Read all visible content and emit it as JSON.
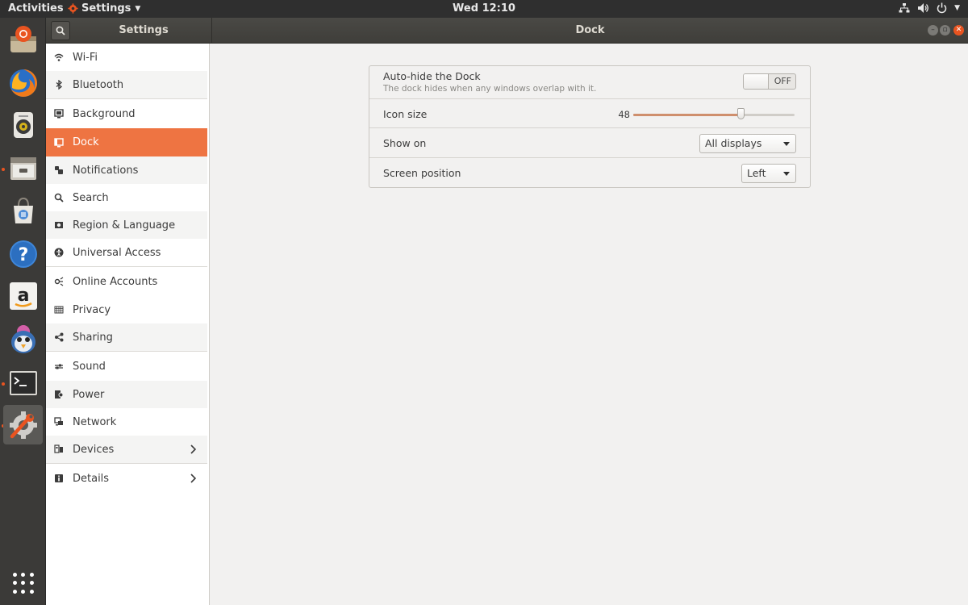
{
  "topbar": {
    "activities": "Activities",
    "app_name": "Settings",
    "clock": "Wed 12:10",
    "tray_icons": [
      "network-icon",
      "volume-icon",
      "power-icon"
    ]
  },
  "dock": {
    "apps": [
      {
        "name": "ubuntu-installer-icon",
        "active": false,
        "running": false
      },
      {
        "name": "firefox-icon",
        "active": false,
        "running": false
      },
      {
        "name": "rhythmbox-icon",
        "active": false,
        "running": false
      },
      {
        "name": "files-icon",
        "active": false,
        "running": true
      },
      {
        "name": "software-center-icon",
        "active": false,
        "running": false
      },
      {
        "name": "help-icon",
        "active": false,
        "running": false
      },
      {
        "name": "amazon-icon",
        "active": false,
        "running": false
      },
      {
        "name": "pidgin-icon",
        "active": false,
        "running": false
      },
      {
        "name": "terminal-icon",
        "active": false,
        "running": true
      },
      {
        "name": "settings-icon",
        "active": true,
        "running": true
      }
    ],
    "show_apps_icon": "grid-icon"
  },
  "header": {
    "sidebar_title": "Settings",
    "panel_title": "Dock"
  },
  "sidebar": {
    "items": [
      {
        "label": "Wi-Fi",
        "icon": "wifi-icon"
      },
      {
        "label": "Bluetooth",
        "icon": "bluetooth-icon"
      },
      {
        "label": "Background",
        "icon": "background-icon"
      },
      {
        "label": "Dock",
        "icon": "dock-icon"
      },
      {
        "label": "Notifications",
        "icon": "notifications-icon"
      },
      {
        "label": "Search",
        "icon": "search-icon"
      },
      {
        "label": "Region & Language",
        "icon": "region-icon"
      },
      {
        "label": "Universal Access",
        "icon": "universal-access-icon"
      },
      {
        "label": "Online Accounts",
        "icon": "online-accounts-icon"
      },
      {
        "label": "Privacy",
        "icon": "privacy-icon"
      },
      {
        "label": "Sharing",
        "icon": "sharing-icon"
      },
      {
        "label": "Sound",
        "icon": "sound-icon"
      },
      {
        "label": "Power",
        "icon": "power-icon"
      },
      {
        "label": "Network",
        "icon": "network-icon"
      },
      {
        "label": "Devices",
        "icon": "devices-icon"
      },
      {
        "label": "Details",
        "icon": "details-icon"
      }
    ],
    "selected": "Dock",
    "accent_color": "#ee7442"
  },
  "dock_settings": {
    "autohide": {
      "label": "Auto-hide the Dock",
      "description": "The dock hides when any windows overlap with it.",
      "state": "OFF"
    },
    "icon_size": {
      "label": "Icon size",
      "value": "48",
      "min": 16,
      "max": 64
    },
    "show_on": {
      "label": "Show on",
      "selected": "All displays"
    },
    "screen_position": {
      "label": "Screen position",
      "selected": "Left"
    }
  }
}
